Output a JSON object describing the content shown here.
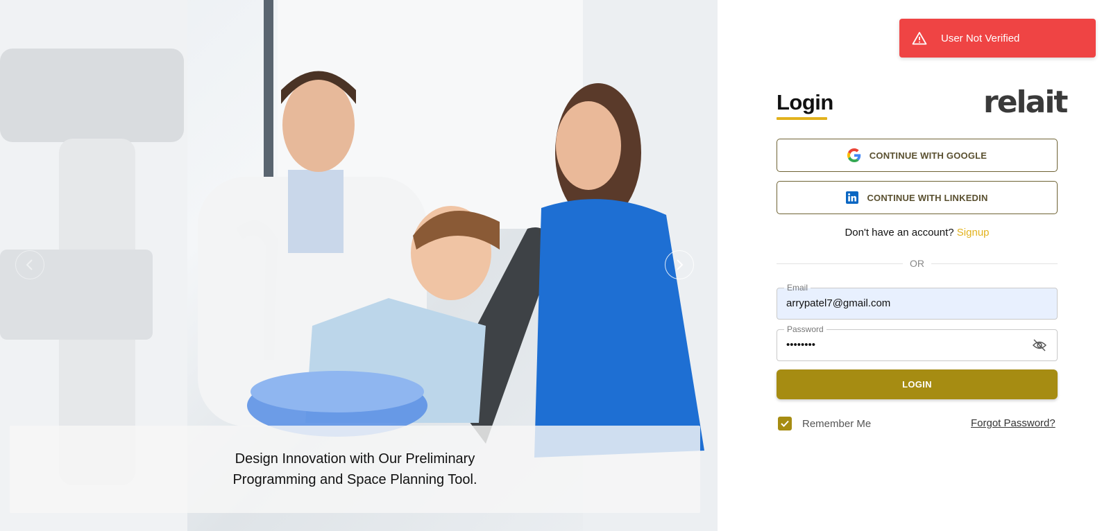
{
  "hero": {
    "caption": "Design Innovation with Our Preliminary Programming and Space Planning Tool.",
    "prev_icon": "chevron-left-icon",
    "next_icon": "chevron-right-icon"
  },
  "toast": {
    "message": "User Not Verified",
    "icon": "warning-icon",
    "color": "#ef4444"
  },
  "login": {
    "title": "Login",
    "brand": "relait",
    "google_label": "CONTINUE WITH GOOGLE",
    "linkedin_label": "CONTINUE WITH LINKEDIN",
    "no_account_text": "Don't have an account?",
    "signup_label": "Signup",
    "or_text": "OR",
    "email_label": "Email",
    "email_value": "arrypatel7@gmail.com",
    "password_label": "Password",
    "password_value": "••••••••",
    "login_button": "LOGIN",
    "remember_label": "Remember Me",
    "remember_checked": true,
    "forgot_label": "Forgot Password?",
    "accent_color": "#e2b21d",
    "button_color": "#a68c12"
  }
}
